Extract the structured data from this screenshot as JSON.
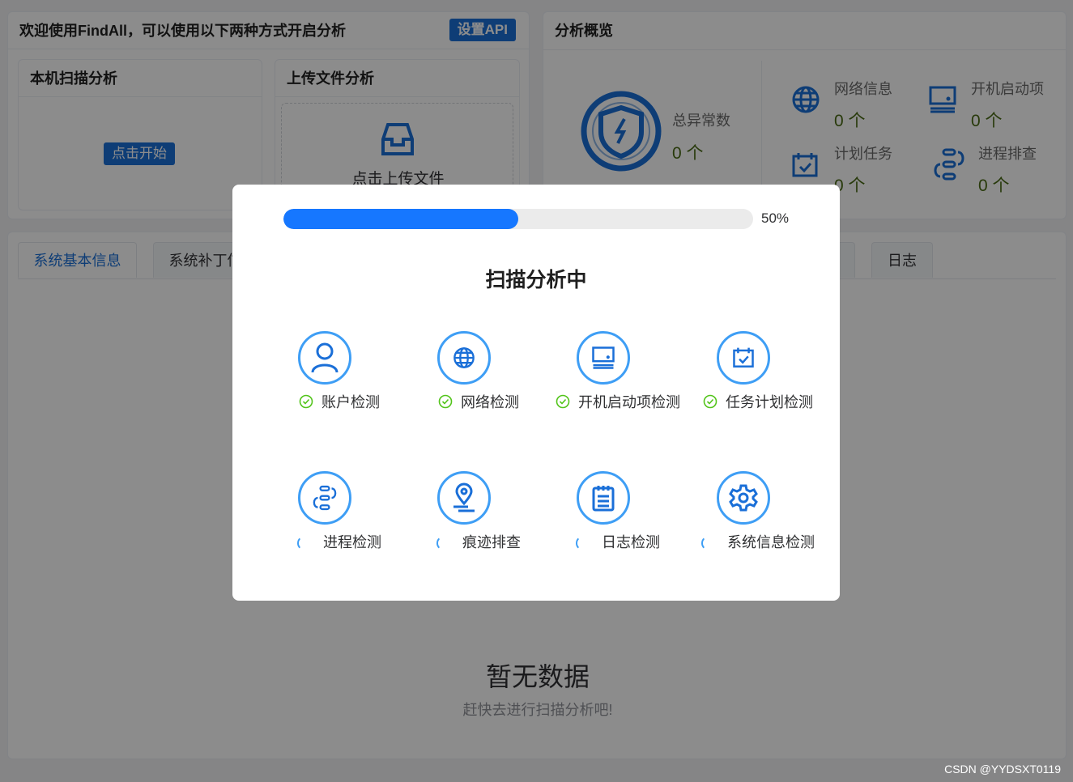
{
  "welcome": {
    "title": "欢迎使用FindAll，可以使用以下两种方式开启分析",
    "api_button": "设置API"
  },
  "local_scan": {
    "title": "本机扫描分析",
    "start_button": "点击开始"
  },
  "upload": {
    "title": "上传文件分析",
    "label": "点击上传文件"
  },
  "overview": {
    "title": "分析概览",
    "total_label": "总异常数",
    "total_value": "0 个",
    "stats": [
      {
        "label": "网络信息",
        "value": "0 个",
        "icon": "globe-icon"
      },
      {
        "label": "开机启动项",
        "value": "0 个",
        "icon": "monitor-icon"
      },
      {
        "label": "计划任务",
        "value": "0 个",
        "icon": "calendar-check-icon"
      },
      {
        "label": "进程排查",
        "value": "0 个",
        "icon": "process-icon"
      }
    ]
  },
  "tabs": [
    {
      "label": "系统基本信息",
      "active": true
    },
    {
      "label": "系统补丁信息",
      "active": false
    },
    {
      "label": "日志",
      "active": false
    }
  ],
  "empty": {
    "title": "暂无数据",
    "subtitle": "赶快去进行扫描分析吧!"
  },
  "modal": {
    "progress": 0.5,
    "progress_text": "50%",
    "title": "扫描分析中",
    "items": [
      {
        "label": "账户检测",
        "status": "done",
        "icon": "user-icon"
      },
      {
        "label": "网络检测",
        "status": "done",
        "icon": "globe-icon"
      },
      {
        "label": "开机启动项检测",
        "status": "done",
        "icon": "monitor-icon"
      },
      {
        "label": "任务计划检测",
        "status": "done",
        "icon": "calendar-check-icon"
      },
      {
        "label": "进程检测",
        "status": "loading",
        "icon": "process-icon"
      },
      {
        "label": "痕迹排查",
        "status": "loading",
        "icon": "location-pin-icon"
      },
      {
        "label": "日志检测",
        "status": "loading",
        "icon": "notepad-icon"
      },
      {
        "label": "系统信息检测",
        "status": "loading",
        "icon": "gear-icon"
      }
    ]
  },
  "colors": {
    "primary": "#1a6fd8",
    "progress": "#1677ff",
    "success": "#52c41a",
    "circle": "#3e9ef5"
  },
  "watermark": "CSDN @YYDSXT0119"
}
